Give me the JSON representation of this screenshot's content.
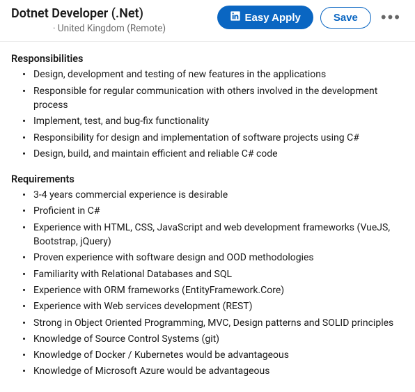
{
  "header": {
    "job_title": "Dotnet Developer (.Net)",
    "location": "United Kingdom (Remote)",
    "easy_apply_label": "Easy Apply",
    "save_label": "Save"
  },
  "sections": {
    "responsibilities": {
      "heading": "Responsibilities",
      "items": [
        "Design, development and testing of new features in the applications",
        "Responsible for regular communication with others involved in the development process",
        "Implement, test, and bug-fix functionality",
        "Responsibility for design and implementation of software projects using C#",
        "Design, build, and maintain efficient and reliable C# code"
      ]
    },
    "requirements": {
      "heading": "Requirements",
      "items": [
        "3-4 years commercial experience is desirable",
        "Proficient in C#",
        "Experience with HTML, CSS, JavaScript and web development frameworks (VueJS, Bootstrap, jQuery)",
        "Proven experience with software design and OOD methodologies",
        "Familiarity with Relational Databases and SQL",
        "Experience with ORM frameworks (EntityFramework.Core)",
        "Experience with Web services development (REST)",
        "Strong in Object Oriented Programming, MVC, Design patterns and SOLID principles",
        "Knowledge of Source Control Systems (git)",
        "Knowledge of Docker / Kubernetes would be advantageous",
        "Knowledge of Microsoft Azure would be advantageous"
      ]
    }
  }
}
